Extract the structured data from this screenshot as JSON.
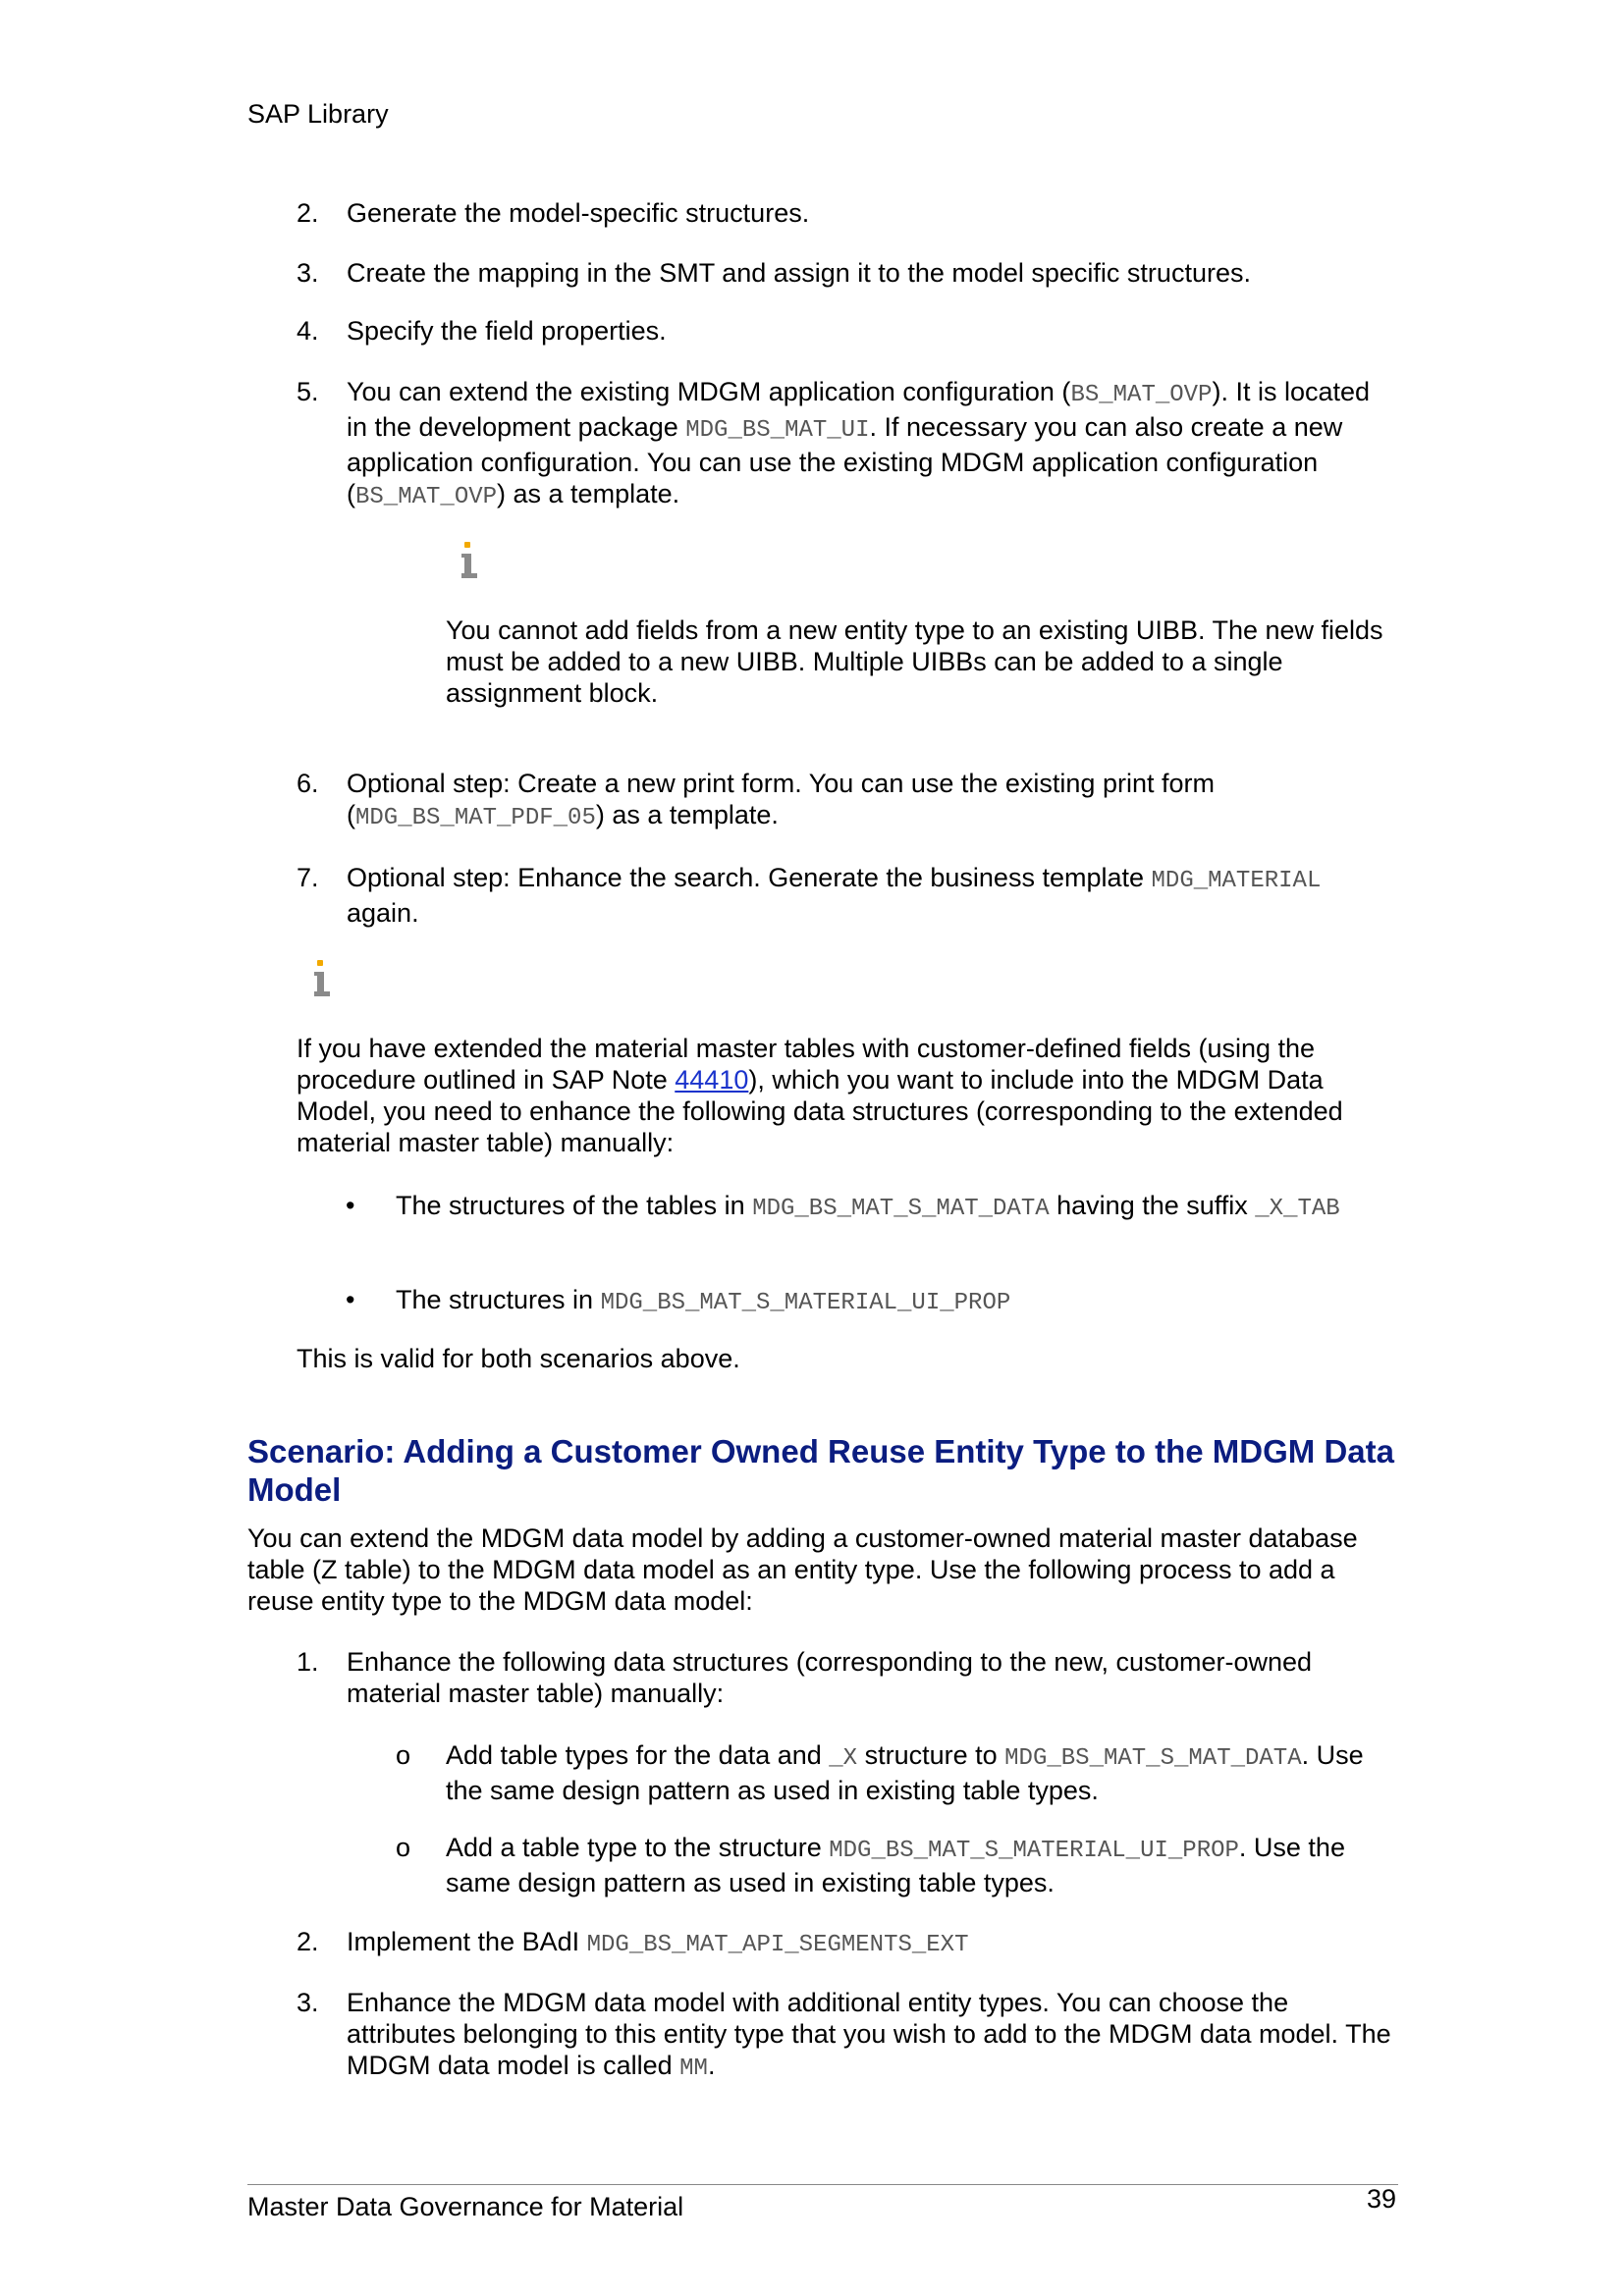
{
  "header": {
    "text": "SAP Library"
  },
  "steps_a": [
    {
      "num": "2.",
      "text": "Generate the model-specific structures."
    },
    {
      "num": "3.",
      "text": "Create the mapping in the SMT and assign it to the model specific structures."
    },
    {
      "num": "4.",
      "text": "Specify the field properties."
    },
    {
      "num": "5.",
      "p1": "You can extend the existing MDGM application configuration (",
      "c1": "BS_MAT_OVP",
      "p2": "). It is located in the development package ",
      "c2": "MDG_BS_MAT_UI",
      "p3": ". If necessary you can also create a new application configuration. You can use the existing MDGM application configuration (",
      "c3": "BS_MAT_OVP",
      "p4": ") as a template."
    }
  ],
  "note1": "You cannot add fields from a new entity type to an existing UIBB. The new fields must be added to a new UIBB. Multiple UIBBs can be added to a single assignment block.",
  "step6": {
    "num": "6.",
    "p1": "Optional step: Create a new print form. You can use the existing print form (",
    "c1": "MDG_BS_MAT_PDF_05",
    "p2": ") as a template."
  },
  "step7": {
    "num": "7.",
    "p1": "Optional step: Enhance the search. Generate the business template ",
    "c1": "MDG_MATERIAL",
    "p2": " again."
  },
  "note2": {
    "p1": "If you have extended the material master tables with customer-defined fields (using the procedure outlined in SAP Note ",
    "link": "44410",
    "p2": "), which you want to include into the MDGM Data Model, you need to enhance the following data structures (corresponding to the extended material master table) manually:"
  },
  "bullets": [
    {
      "mark": "•",
      "p1": "The structures of the tables in ",
      "c1": "MDG_BS_MAT_S_MAT_DATA",
      "p2": " having the suffix ",
      "c2": "_X_TAB"
    },
    {
      "mark": "•",
      "p1": "The structures in ",
      "c1": "MDG_BS_MAT_S_MATERIAL_UI_PROP"
    }
  ],
  "valid_text": "This is valid for both scenarios above.",
  "section": {
    "heading": "Scenario: Adding a Customer Owned Reuse Entity Type to the MDGM Data Model",
    "intro": "You can extend the MDGM data model by adding a customer-owned material master database table (Z table) to the MDGM data model as an entity type. Use the following process to add a reuse entity type to the MDGM data model:",
    "step1": {
      "num": "1.",
      "text": "Enhance the following data structures (corresponding to the new, customer-owned material master table) manually:"
    },
    "sub": [
      {
        "mark": "o",
        "p1": "Add table types for the data and ",
        "c1": "_X",
        "p2": " structure to ",
        "c2": "MDG_BS_MAT_S_MAT_DATA",
        "p3": ". Use the same design pattern as used in existing table types."
      },
      {
        "mark": "o",
        "p1": "Add a table type to the structure ",
        "c1": "MDG_BS_MAT_S_MATERIAL_UI_PROP",
        "p2": ". Use the same design pattern as used in existing table types."
      }
    ],
    "step2": {
      "num": "2.",
      "p1": "Implement the BAdI ",
      "c1": "MDG_BS_MAT_API_SEGMENTS_EXT"
    },
    "step3": {
      "num": "3.",
      "p1": "Enhance the MDGM data model with additional entity types. You can choose the attributes belonging to this entity type that you wish to add to the MDGM data model. The MDGM data model is called ",
      "c1": "MM",
      "p2": "."
    }
  },
  "footer": {
    "title": "Master Data Governance for Material",
    "page": "39"
  }
}
